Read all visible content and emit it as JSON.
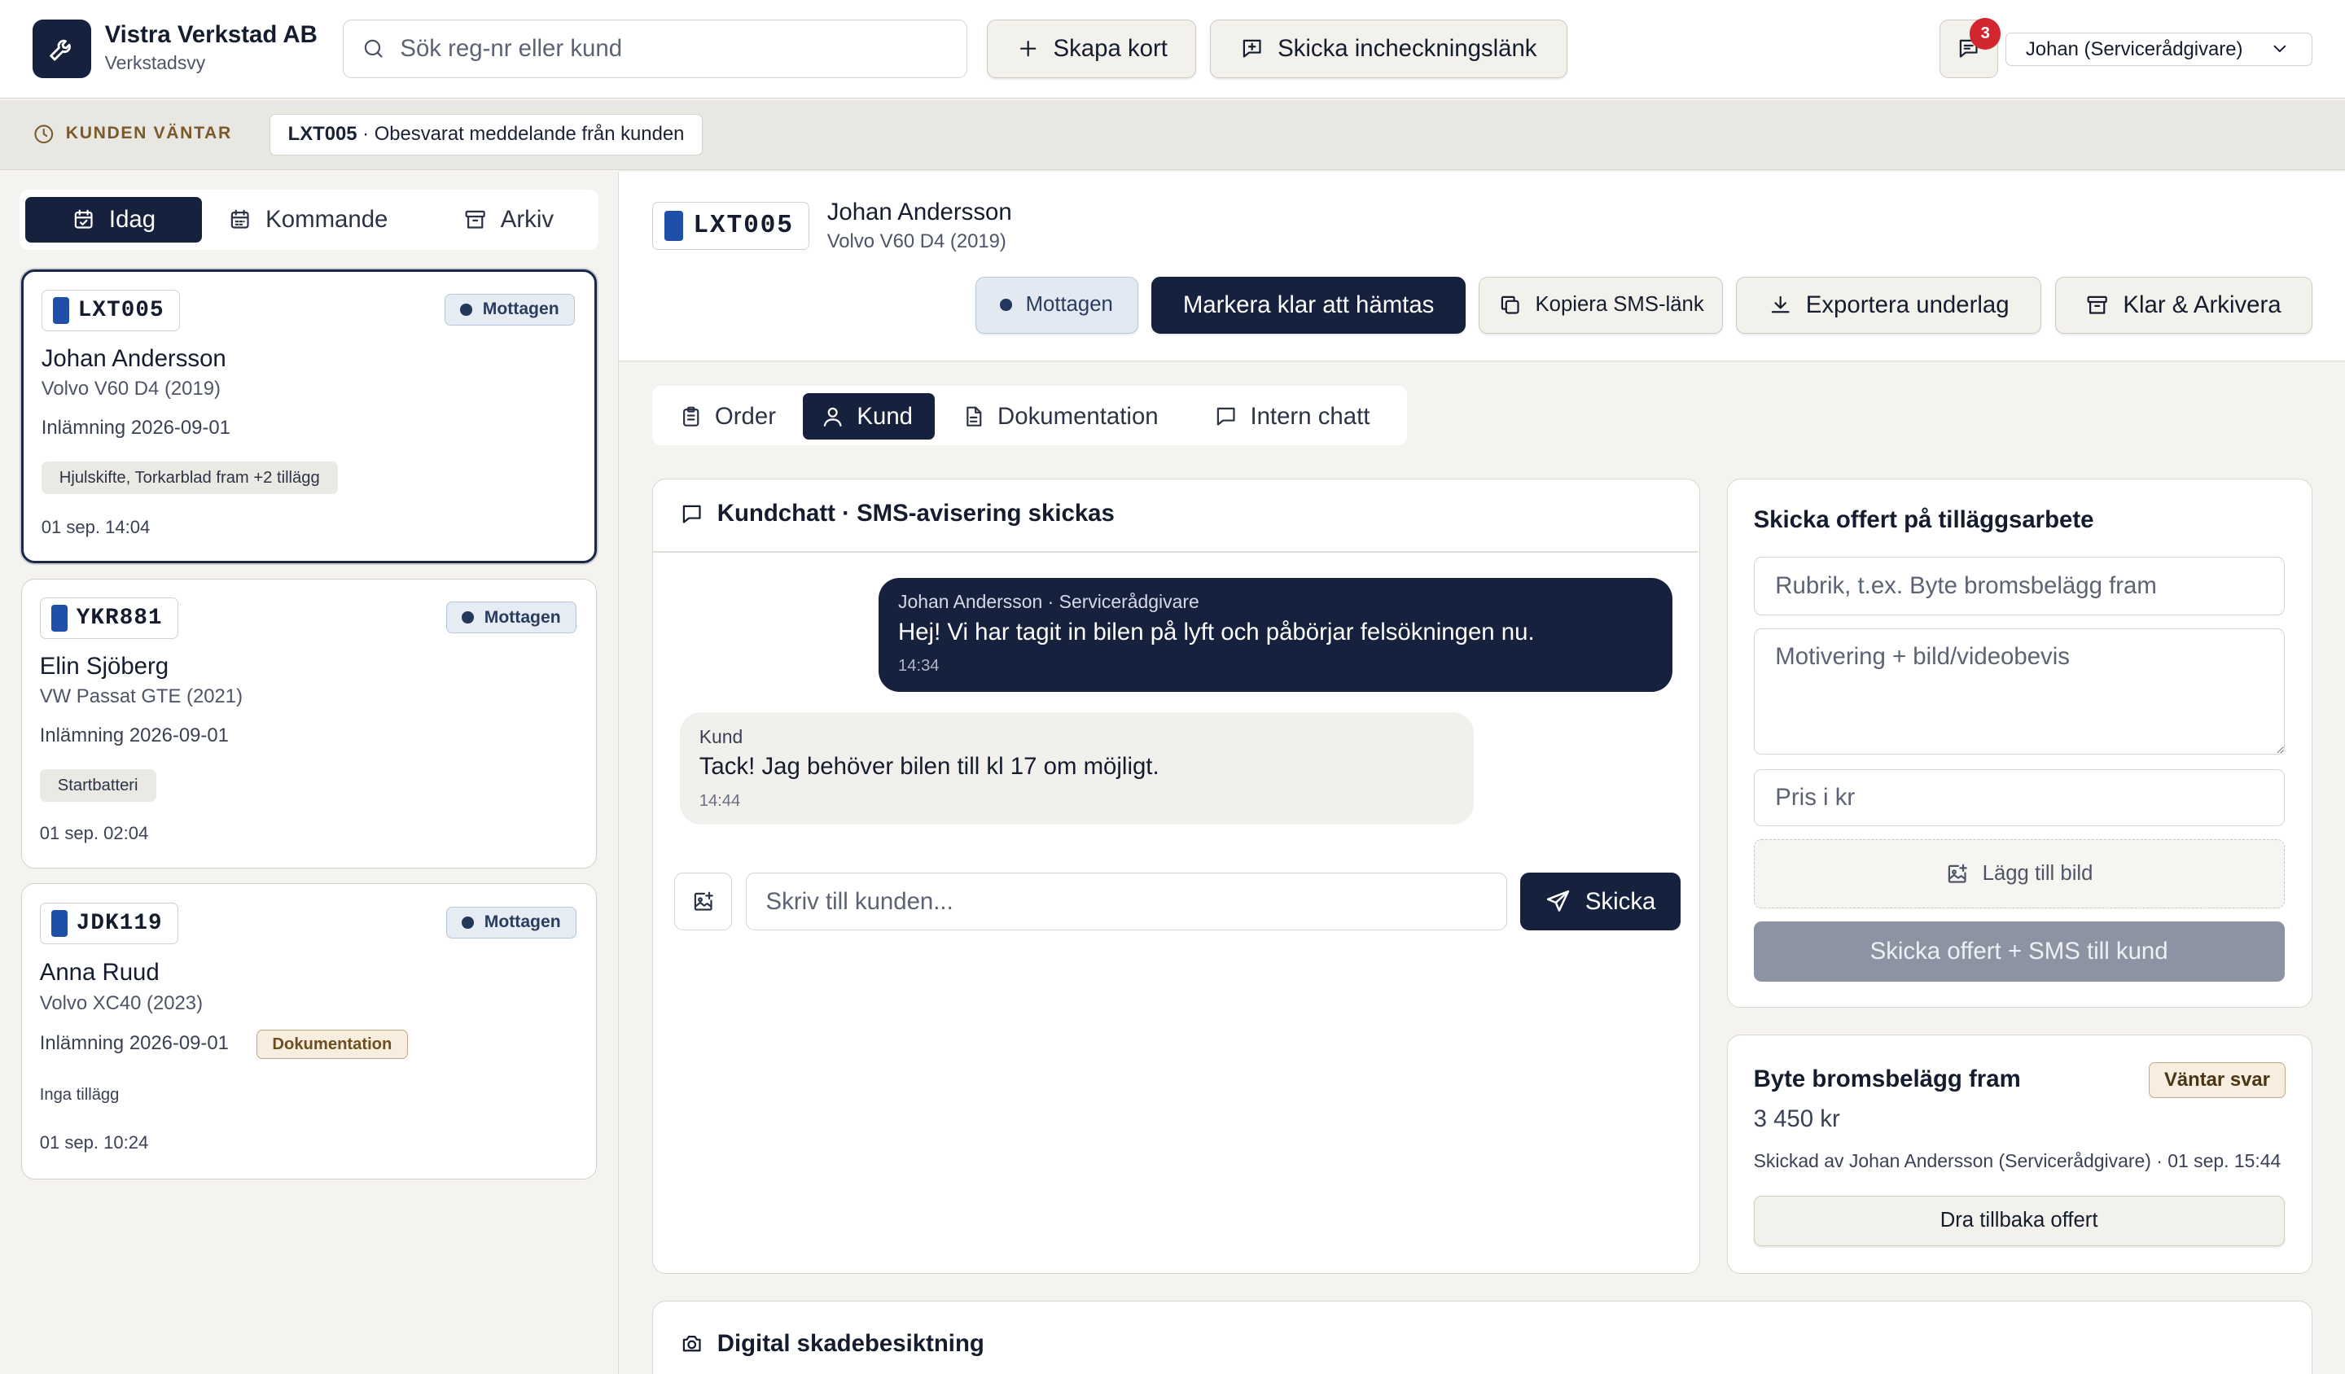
{
  "app": {
    "name": "Vistra Verkstad AB",
    "subtitle": "Verkstadsvy",
    "icon": "wrench-icon"
  },
  "header": {
    "search_placeholder": "Sök reg-nr eller kund",
    "create_card_label": "Skapa kort",
    "send_checkin_label": "Skicka incheckningslänk",
    "notification_count": "3",
    "user_label": "Johan (Servicerådgivare)"
  },
  "waiting": {
    "label": "KUNDEN VÄNTAR",
    "chip_plate": "LXT005",
    "chip_text": " · Obesvarat meddelande från kunden"
  },
  "left_tabs": [
    {
      "label": "Idag",
      "icon": "calendar-check-icon",
      "active": true
    },
    {
      "label": "Kommande",
      "icon": "calendar-icon",
      "active": false
    },
    {
      "label": "Arkiv",
      "icon": "archive-icon",
      "active": false
    }
  ],
  "tickets": [
    {
      "plate": "LXT005",
      "status": "Mottagen",
      "customer": "Johan Andersson",
      "car": "Volvo V60 D4 (2019)",
      "delivery": "Inlämning 2026-09-01",
      "tag": "Hjulskifte, Torkarblad fram +2 tillägg",
      "time": "01 sep. 14:04"
    },
    {
      "plate": "YKR881",
      "status": "Mottagen",
      "customer": "Elin Sjöberg",
      "car": "VW Passat GTE (2021)",
      "delivery": "Inlämning 2026-09-01",
      "tag": "Startbatteri",
      "time": "01 sep. 02:04"
    },
    {
      "plate": "JDK119",
      "status": "Mottagen",
      "customer": "Anna Ruud",
      "car": "Volvo XC40 (2023)",
      "delivery": "Inlämning 2026-09-01",
      "badge": "Dokumentation",
      "note": "Inga tillägg",
      "time": "01 sep. 10:24"
    }
  ],
  "detail": {
    "plate": "LXT005",
    "customer": "Johan Andersson",
    "car": "Volvo V60 D4 (2019)",
    "status": "Mottagen",
    "mark_ready_label": "Markera klar att hämtas",
    "copy_sms_label": "Kopiera SMS-länk",
    "export_label": "Exportera underlag",
    "archive_label": "Klar & Arkivera"
  },
  "main_tabs": [
    {
      "label": "Order",
      "icon": "clipboard-icon",
      "active": false
    },
    {
      "label": "Kund",
      "icon": "user-icon",
      "active": true
    },
    {
      "label": "Dokumentation",
      "icon": "document-icon",
      "active": false
    },
    {
      "label": "Intern chatt",
      "icon": "chat-bubble-icon",
      "active": false
    }
  ],
  "chat": {
    "title": "Kundchatt · SMS-avisering skickas",
    "messages": [
      {
        "author": "Johan Andersson · Servicerådgivare",
        "text": "Hej! Vi har tagit in bilen på lyft och påbörjar felsökningen nu.",
        "time": "14:34",
        "direction": "out"
      },
      {
        "author": "Kund",
        "text": "Tack! Jag behöver bilen till kl 17 om möjligt.",
        "time": "14:44",
        "direction": "in"
      }
    ],
    "input_placeholder": "Skriv till kunden...",
    "send_label": "Skicka"
  },
  "offer": {
    "title": "Skicka offert på tilläggsarbete",
    "title_placeholder": "Rubrik, t.ex. Byte bromsbelägg fram",
    "motivation_placeholder": "Motivering + bild/videobevis",
    "price_placeholder": "Pris i kr",
    "add_image_label": "Lägg till bild",
    "submit_label": "Skicka offert + SMS till kund"
  },
  "pending_offer": {
    "title": "Byte bromsbelägg fram",
    "status": "Väntar svar",
    "price": "3 450 kr",
    "meta": "Skickad av Johan Andersson (Servicerådgivare) · 01 sep. 15:44",
    "withdraw_label": "Dra tillbaka offert"
  },
  "inspection": {
    "title": "Digital skadebesiktning"
  },
  "colors": {
    "navy": "#16213e",
    "status_bg": "#e6ecf4",
    "badge_warn": "#f7eedf",
    "notif_red": "#d3262f",
    "waiting_accent": "#7a5a2a"
  }
}
